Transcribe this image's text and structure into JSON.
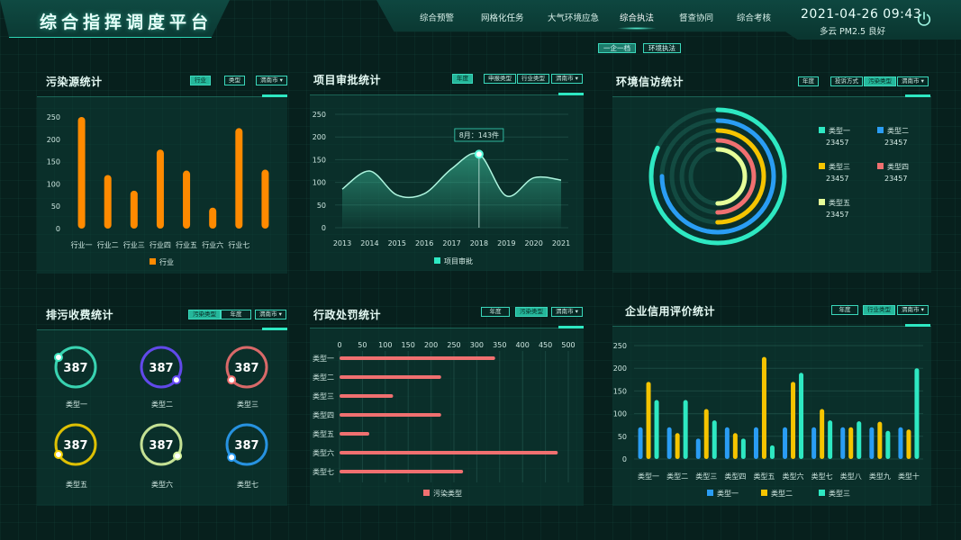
{
  "header": {
    "title": "综合指挥调度平台",
    "nav": [
      "综合预警",
      "网格化任务",
      "大气环境应急",
      "综合执法",
      "督查协同",
      "综合考核"
    ],
    "active_nav": "综合执法",
    "datetime": "2021-04-26 09:43",
    "weather": "多云 PM2.5  良好",
    "subtabs": [
      "一企一档",
      "环境执法"
    ]
  },
  "panels": {
    "pollution": {
      "title": "污染源统计",
      "filters": [
        "行业",
        "类型",
        "渭南市"
      ],
      "active_filter": "行业"
    },
    "approval": {
      "title": "项目审批统计",
      "filters": [
        "年度",
        "申报类型",
        "行业类型",
        "渭南市"
      ],
      "active_filter": "年度",
      "tooltip": "8月：143件"
    },
    "petition": {
      "title": "环境信访统计",
      "filters": [
        "年度",
        "投诉方式",
        "污染类型",
        "渭南市"
      ],
      "active_filter": "污染类型"
    },
    "fee": {
      "title": "排污收费统计",
      "filters": [
        "污染类型",
        "年度",
        "渭南市"
      ],
      "active_filter": "污染类型"
    },
    "penalty": {
      "title": "行政处罚统计",
      "filters": [
        "年度",
        "污染类型",
        "渭南市"
      ],
      "active_filter": "污染类型"
    },
    "credit": {
      "title": "企业信用评价统计",
      "filters": [
        "年度",
        "行业类型",
        "渭南市"
      ],
      "active_filter": "行业类型"
    }
  },
  "colors": {
    "accent": "#2ee8c2",
    "orange": "#ff8a00",
    "blue": "#2a9df4",
    "yellow": "#f5c400",
    "red": "#f07070",
    "teal": "#2ee8c2",
    "lime": "#e6ff99"
  },
  "chart_data": [
    {
      "id": "pollution",
      "type": "bar",
      "categories": [
        "行业一",
        "行业二",
        "行业三",
        "行业四",
        "行业五",
        "行业六",
        "行业七"
      ],
      "series": [
        {
          "name": "行业",
          "values": [
            250,
            120,
            85,
            177,
            130,
            47,
            225,
            132
          ]
        }
      ],
      "ylim": [
        0,
        250
      ],
      "yticks": [
        0,
        50,
        100,
        150,
        200,
        250
      ],
      "legend": "bottom"
    },
    {
      "id": "approval",
      "type": "area",
      "x": [
        "2013",
        "2014",
        "2015",
        "2016",
        "2017",
        "2018",
        "2019",
        "2020",
        "2021"
      ],
      "series": [
        {
          "name": "项目审批",
          "values": [
            85,
            125,
            72,
            75,
            130,
            162,
            70,
            110,
            105
          ]
        }
      ],
      "ylim": [
        0,
        250
      ],
      "yticks": [
        0,
        50,
        100,
        150,
        200,
        250
      ],
      "legend": "bottom"
    },
    {
      "id": "petition",
      "type": "pie",
      "series": [
        {
          "name": "类型一",
          "value": 23457
        },
        {
          "name": "类型二",
          "value": 23457
        },
        {
          "name": "类型三",
          "value": 23457
        },
        {
          "name": "类型四",
          "value": 23457
        },
        {
          "name": "类型五",
          "value": 23457
        }
      ],
      "ring_fractions": [
        0.82,
        0.75,
        0.5,
        0.5,
        0.5
      ],
      "legend": "right"
    },
    {
      "id": "fee",
      "type": "pie",
      "series": [
        {
          "name": "类型一",
          "value": 387
        },
        {
          "name": "类型二",
          "value": 387
        },
        {
          "name": "类型三",
          "value": 387
        },
        {
          "name": "类型五",
          "value": 387
        },
        {
          "name": "类型六",
          "value": 387
        },
        {
          "name": "类型七",
          "value": 387
        }
      ]
    },
    {
      "id": "penalty",
      "type": "bar",
      "orientation": "horizontal",
      "categories": [
        "类型一",
        "类型二",
        "类型三",
        "类型四",
        "类型五",
        "类型六",
        "类型七"
      ],
      "series": [
        {
          "name": "污染类型",
          "values": [
            340,
            222,
            117,
            222,
            65,
            477,
            270
          ]
        }
      ],
      "xlim": [
        0,
        500
      ],
      "xticks": [
        0,
        50,
        100,
        150,
        200,
        250,
        300,
        350,
        400,
        450,
        500
      ],
      "legend": "bottom"
    },
    {
      "id": "credit",
      "type": "bar",
      "categories": [
        "类型一",
        "类型二",
        "类型三",
        "类型四",
        "类型五",
        "类型六",
        "类型七",
        "类型八",
        "类型九",
        "类型十"
      ],
      "series": [
        {
          "name": "类型一",
          "values": [
            70,
            70,
            45,
            70,
            70,
            70,
            70,
            70,
            70,
            70
          ]
        },
        {
          "name": "类型二",
          "values": [
            170,
            57,
            110,
            57,
            225,
            170,
            110,
            70,
            82,
            65
          ]
        },
        {
          "name": "类型三",
          "values": [
            130,
            130,
            85,
            45,
            30,
            190,
            85,
            83,
            62,
            200
          ]
        }
      ],
      "ylim": [
        0,
        250
      ],
      "yticks": [
        0,
        50,
        100,
        150,
        200,
        250
      ],
      "legend": "bottom"
    }
  ]
}
